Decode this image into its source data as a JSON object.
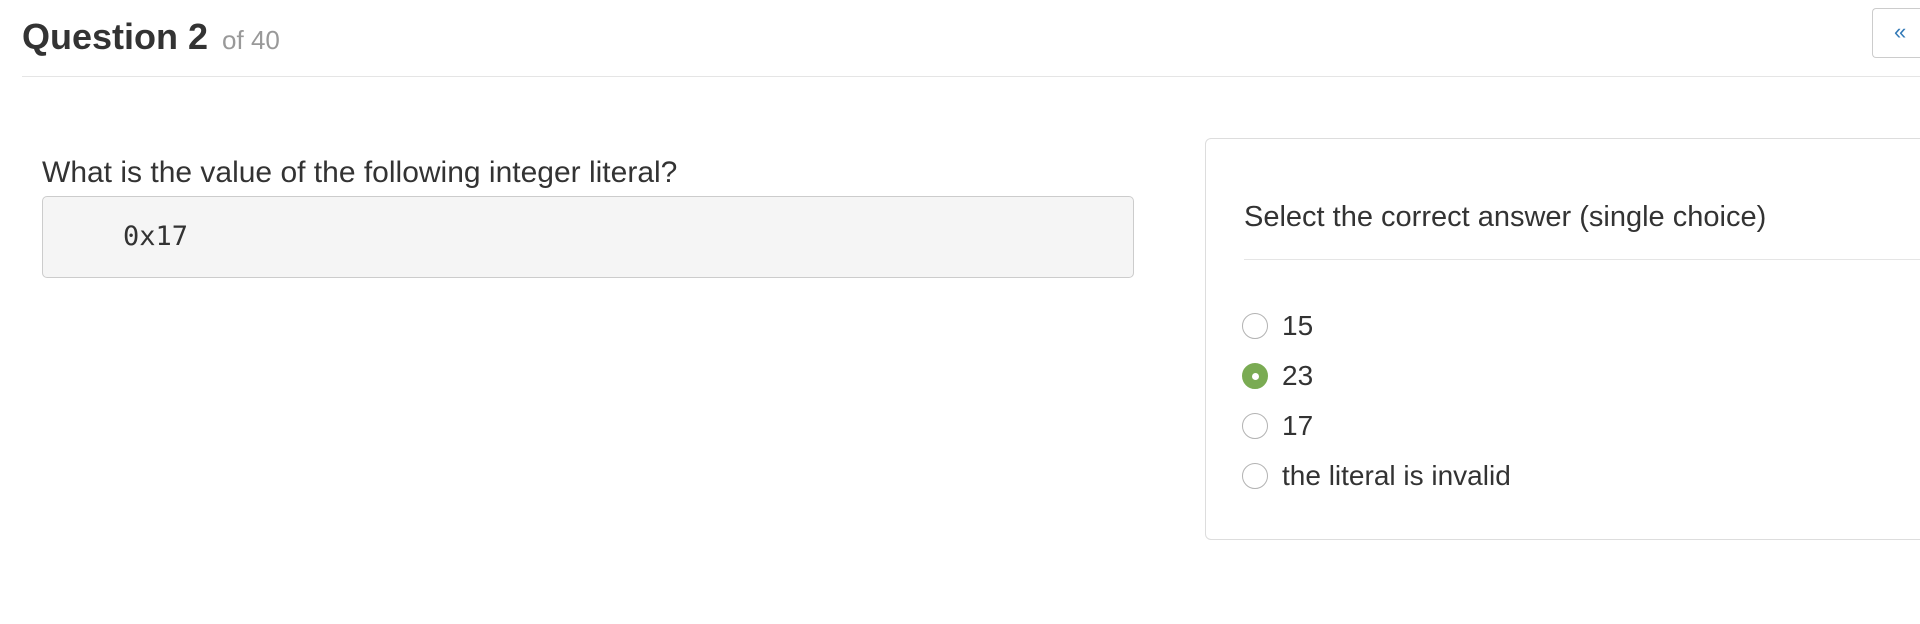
{
  "header": {
    "title": "Question 2",
    "progress": "of 40",
    "nav_button": "«"
  },
  "question": {
    "text": "What is the value of the following integer literal?",
    "code": "0x17"
  },
  "answer_panel": {
    "heading": "Select the correct answer (single choice)",
    "options": [
      {
        "label": "15",
        "selected": false
      },
      {
        "label": "23",
        "selected": true
      },
      {
        "label": "17",
        "selected": false
      },
      {
        "label": "the literal is invalid",
        "selected": false
      }
    ]
  },
  "colors": {
    "selected_radio": "#7aab53",
    "nav_button_text": "#337ab7"
  }
}
